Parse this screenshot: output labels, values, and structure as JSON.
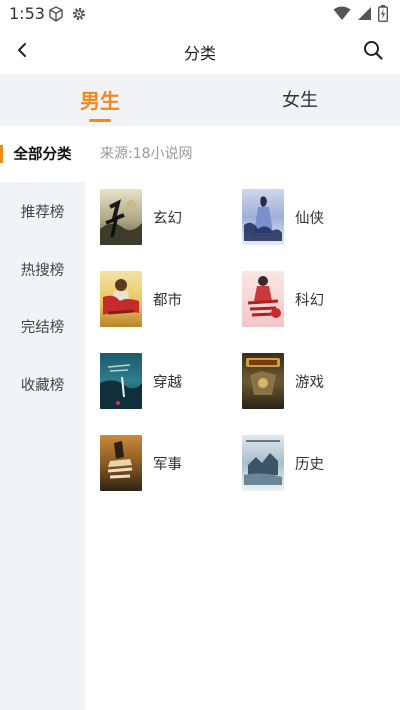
{
  "status_bar": {
    "time": "1:53"
  },
  "header": {
    "title": "分类"
  },
  "gender_tabs": [
    {
      "label": "男生",
      "active": true
    },
    {
      "label": "女生",
      "active": false
    }
  ],
  "sidebar": {
    "items": [
      {
        "label": "全部分类",
        "active": true
      },
      {
        "label": "推荐榜",
        "active": false
      },
      {
        "label": "热搜榜",
        "active": false
      },
      {
        "label": "完结榜",
        "active": false
      },
      {
        "label": "收藏榜",
        "active": false
      }
    ]
  },
  "main": {
    "source": "来源:18小说网",
    "categories": [
      {
        "label": "玄幻"
      },
      {
        "label": "仙侠"
      },
      {
        "label": "都市"
      },
      {
        "label": "科幻"
      },
      {
        "label": "穿越"
      },
      {
        "label": "游戏"
      },
      {
        "label": "军事"
      },
      {
        "label": "历史"
      }
    ]
  },
  "colors": {
    "accent": "#f08a1d",
    "panel": "#f2f3f7"
  }
}
